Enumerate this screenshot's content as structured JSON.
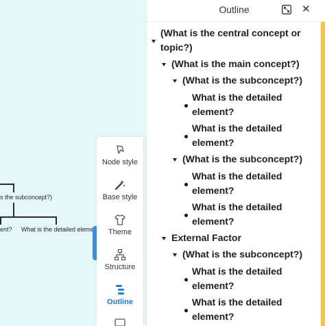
{
  "canvas": {
    "node_subconcept_partial": "s the subconcept?)",
    "node_element_partial_left": "ent?",
    "node_element_partial_right": "What is the detailed eleme"
  },
  "toolbar": {
    "items": [
      {
        "label": "Node style",
        "icon": "node-style-icon"
      },
      {
        "label": "Base style",
        "icon": "magic-wand-icon"
      },
      {
        "label": "Theme",
        "icon": "shirt-icon"
      },
      {
        "label": "Structure",
        "icon": "structure-icon"
      },
      {
        "label": "Outline",
        "icon": "outline-icon",
        "active": true
      }
    ],
    "active_color": "#1f7ae0"
  },
  "panel": {
    "title": "Outline",
    "root": {
      "label_line1": "(What is the central concept or",
      "label_line2": "topic?)"
    },
    "main": "(What is the main concept?)",
    "sub1": "(What is the subconcept?)",
    "sub1_el1_line1": "What is the detailed",
    "sub1_el1_line2": "element?",
    "sub1_el2_line1": "What is the detailed",
    "sub1_el2_line2": "element?",
    "sub2": "(What is the subconcept?)",
    "sub2_el1_line1": "What is the detailed",
    "sub2_el1_line2": "element?",
    "sub2_el2_line1": "What is the detailed",
    "sub2_el2_line2": "element?",
    "external": "External Factor",
    "sub3": "(What is the subconcept?)",
    "sub3_el1_line1": "What is the detailed",
    "sub3_el1_line2": "element?",
    "sub3_el2_line1": "What is the detailed",
    "sub3_el2_line2": "element?"
  }
}
